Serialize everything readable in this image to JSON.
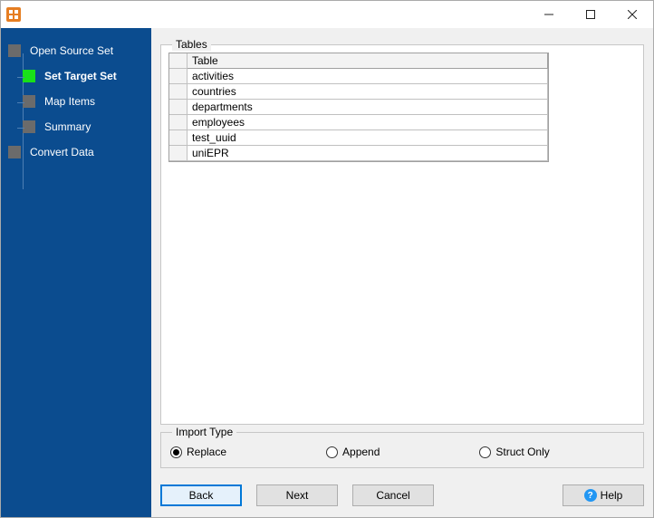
{
  "titlebar": {
    "title": ""
  },
  "sidebar": {
    "items": [
      {
        "label": "Open Source Set",
        "active": false,
        "child": false
      },
      {
        "label": "Set Target Set",
        "active": true,
        "child": true
      },
      {
        "label": "Map Items",
        "active": false,
        "child": true
      },
      {
        "label": "Summary",
        "active": false,
        "child": true
      },
      {
        "label": "Convert Data",
        "active": false,
        "child": false
      }
    ]
  },
  "main": {
    "tables_label": "Tables",
    "table": {
      "header": "Table",
      "rows": [
        "activities",
        "countries",
        "departments",
        "employees",
        "test_uuid",
        "uniEPR"
      ]
    },
    "import_type": {
      "label": "Import Type",
      "options": [
        {
          "label": "Replace",
          "checked": true
        },
        {
          "label": "Append",
          "checked": false
        },
        {
          "label": "Struct Only",
          "checked": false
        }
      ]
    }
  },
  "buttons": {
    "back": "Back",
    "next": "Next",
    "cancel": "Cancel",
    "help": "Help"
  }
}
